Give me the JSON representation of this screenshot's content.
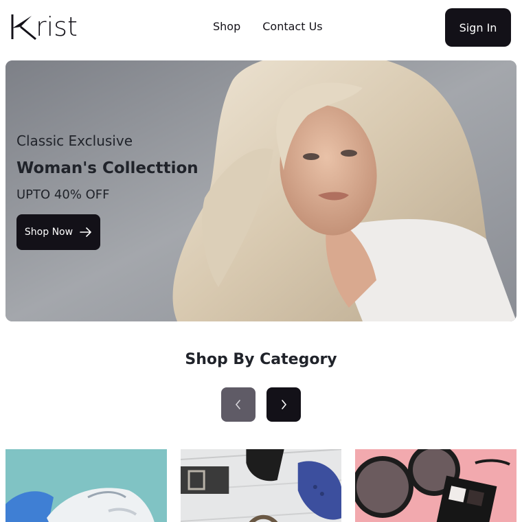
{
  "header": {
    "brand": "rist",
    "nav": [
      "Shop",
      "Contact Us"
    ],
    "sign_in_label": "Sign In"
  },
  "hero": {
    "eyebrow": "Classic Exclusive",
    "title": "Woman's Collecttion",
    "discount": "UPTO 40% OFF",
    "cta_label": "Shop Now"
  },
  "category": {
    "title": "Shop By Category",
    "prev_icon": "chevron-left-icon",
    "next_icon": "chevron-right-icon",
    "cards": [
      "sneakers",
      "mens-accessories",
      "sunglasses-makeup"
    ]
  },
  "colors": {
    "primary": "#131118",
    "secondary_button": "#5f5b66",
    "heading": "#20232a"
  }
}
